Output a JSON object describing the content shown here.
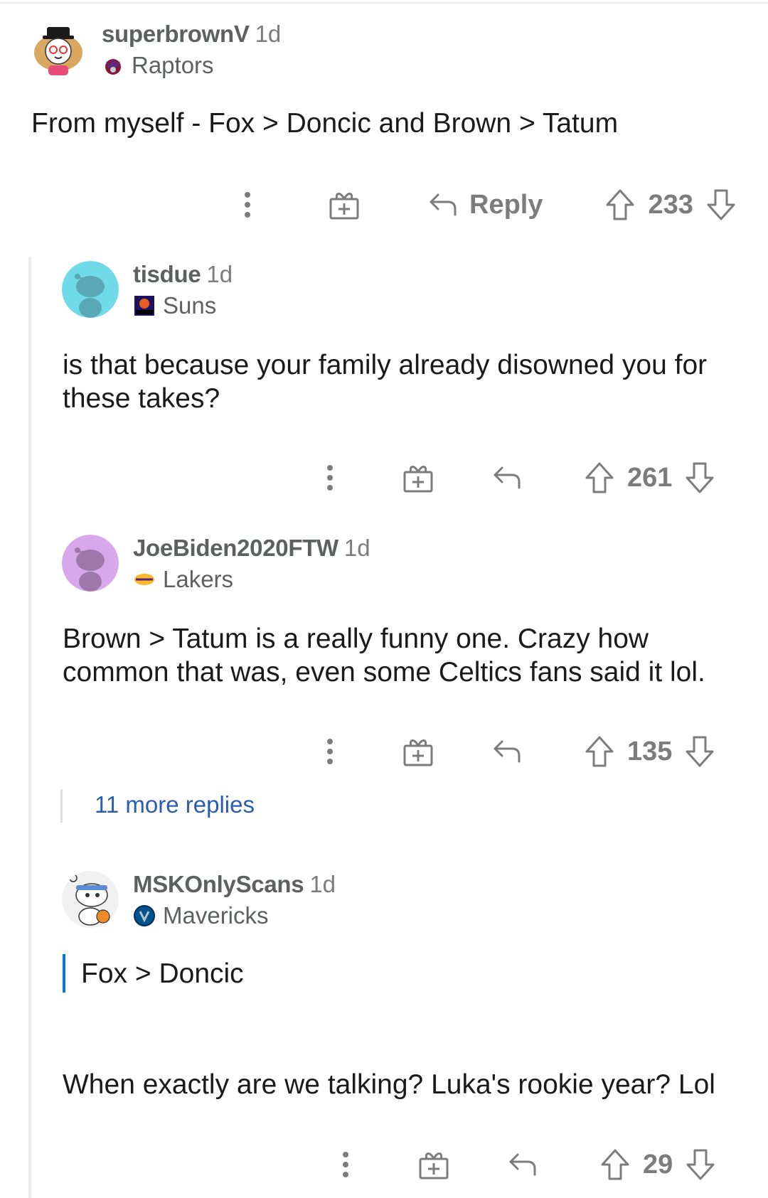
{
  "actions": {
    "reply_label": "Reply"
  },
  "more_replies": "11 more replies",
  "comments": [
    {
      "username": "superbrownV",
      "age": "1d",
      "flair": "Raptors",
      "body": "From myself - Fox > Doncic and Brown > Tatum",
      "score": "233"
    },
    {
      "username": "tisdue",
      "age": "1d",
      "flair": "Suns",
      "body_lines": [
        "is that because your family already disowned you for",
        "these takes?"
      ],
      "score": "261"
    },
    {
      "username": "JoeBiden2020FTW",
      "age": "1d",
      "flair": "Lakers",
      "body_lines": [
        "Brown > Tatum is a really funny one. Crazy how",
        "common that was, even some Celtics fans said it lol."
      ],
      "score": "135"
    },
    {
      "username": "MSKOnlyScans",
      "age": "1d",
      "flair": "Mavericks",
      "quote": "Fox > Doncic",
      "body": "When exactly are we talking? Luka's rookie year? Lol",
      "score": "29"
    }
  ],
  "colors": {
    "link": "#2a5db0",
    "quote_bar": "#0079d3",
    "icon_gray": "#7c7c7c",
    "text": "#1a1a1b"
  }
}
